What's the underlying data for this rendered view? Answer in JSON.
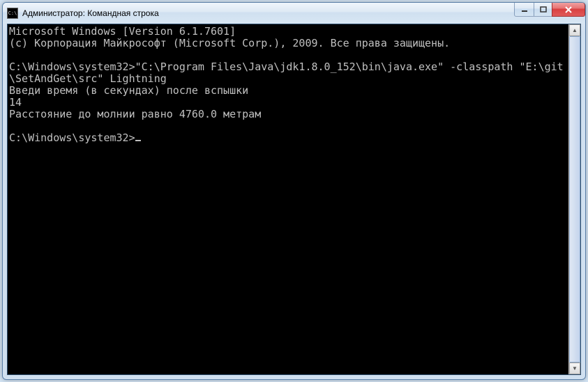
{
  "window": {
    "title": "Администратор: Командная строка"
  },
  "terminal": {
    "line1": "Microsoft Windows [Version 6.1.7601]",
    "line2": "(c) Корпорация Майкрософт (Microsoft Corp.), 2009. Все права защищены.",
    "blank1": "",
    "cmdline": "C:\\Windows\\system32>\"C:\\Program Files\\Java\\jdk1.8.0_152\\bin\\java.exe\" -classpath \"E:\\git\\SetAndGet\\src\" Lightning",
    "out1": "Введи время (в секундах) после вспышки",
    "out2": "14",
    "out3": "Расстояние до молнии равно 4760.0 метрам",
    "blank2": "",
    "prompt": "C:\\Windows\\system32>"
  }
}
